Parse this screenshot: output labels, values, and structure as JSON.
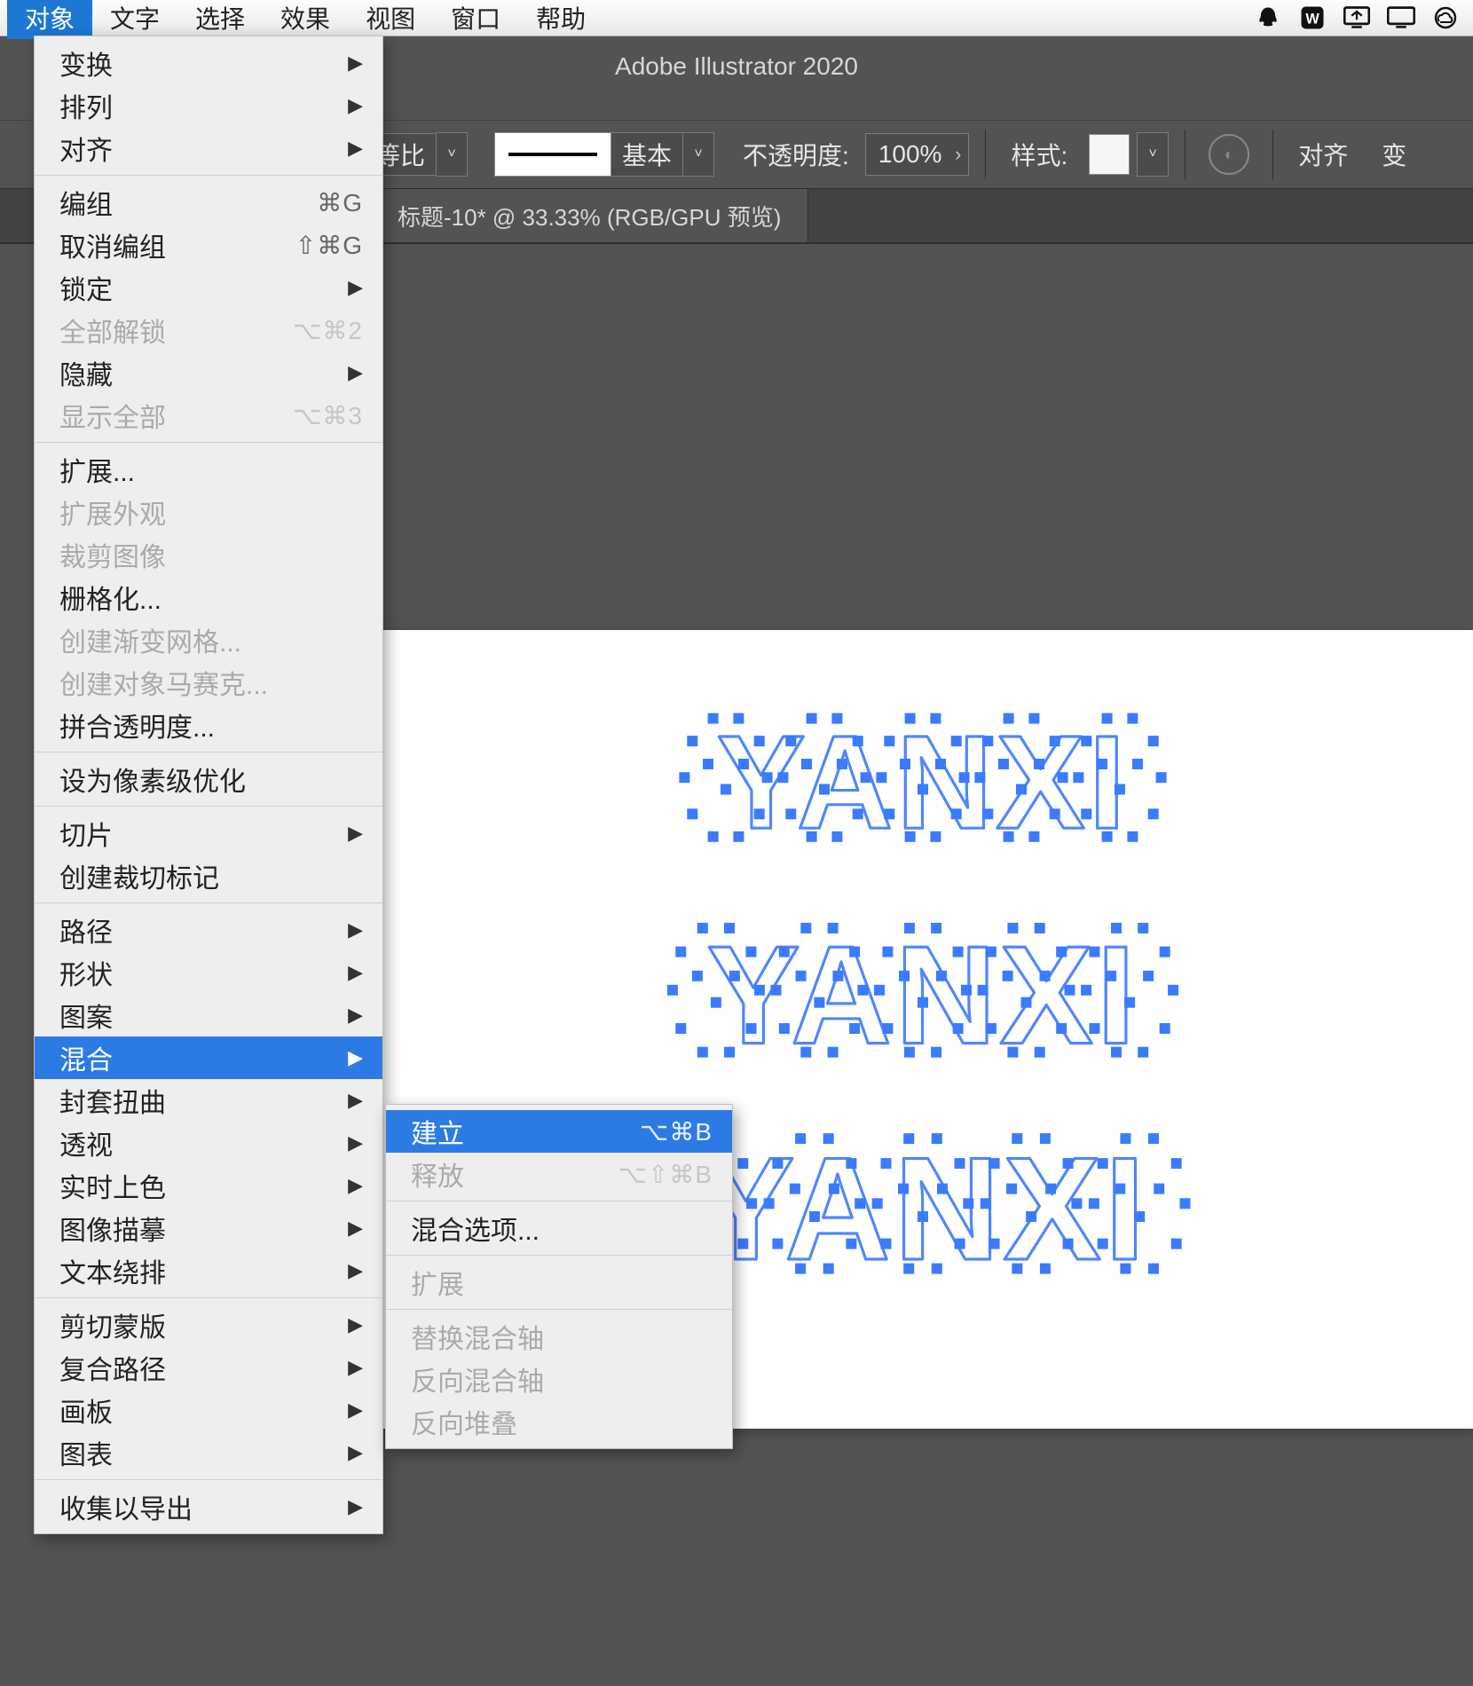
{
  "menubar": {
    "items": [
      "对象",
      "文字",
      "选择",
      "效果",
      "视图",
      "窗口",
      "帮助"
    ],
    "active_index": 0
  },
  "app": {
    "title": "Adobe Illustrator 2020"
  },
  "control_bar": {
    "proportion": "等比",
    "stroke_style": "基本",
    "opacity_label": "不透明度:",
    "opacity_value": "100%",
    "style_label": "样式:",
    "align_label": "对齐",
    "transform_label": "变"
  },
  "doc_tab": {
    "label": "标题-10* @ 33.33% (RGB/GPU 预览)"
  },
  "canvas": {
    "text": "YANXI"
  },
  "object_menu": {
    "groups": [
      [
        {
          "label": "变换",
          "submenu": true
        },
        {
          "label": "排列",
          "submenu": true
        },
        {
          "label": "对齐",
          "submenu": true
        }
      ],
      [
        {
          "label": "编组",
          "shortcut": "⌘G"
        },
        {
          "label": "取消编组",
          "shortcut": "⇧⌘G"
        },
        {
          "label": "锁定",
          "submenu": true
        },
        {
          "label": "全部解锁",
          "shortcut": "⌥⌘2",
          "disabled": true
        },
        {
          "label": "隐藏",
          "submenu": true
        },
        {
          "label": "显示全部",
          "shortcut": "⌥⌘3",
          "disabled": true
        }
      ],
      [
        {
          "label": "扩展..."
        },
        {
          "label": "扩展外观",
          "disabled": true
        },
        {
          "label": "裁剪图像",
          "disabled": true
        },
        {
          "label": "栅格化..."
        },
        {
          "label": "创建渐变网格...",
          "disabled": true
        },
        {
          "label": "创建对象马赛克...",
          "disabled": true
        },
        {
          "label": "拼合透明度..."
        }
      ],
      [
        {
          "label": "设为像素级优化"
        }
      ],
      [
        {
          "label": "切片",
          "submenu": true
        },
        {
          "label": "创建裁切标记"
        }
      ],
      [
        {
          "label": "路径",
          "submenu": true
        },
        {
          "label": "形状",
          "submenu": true
        },
        {
          "label": "图案",
          "submenu": true
        },
        {
          "label": "混合",
          "submenu": true,
          "highlight": true
        },
        {
          "label": "封套扭曲",
          "submenu": true
        },
        {
          "label": "透视",
          "submenu": true
        },
        {
          "label": "实时上色",
          "submenu": true
        },
        {
          "label": "图像描摹",
          "submenu": true
        },
        {
          "label": "文本绕排",
          "submenu": true
        }
      ],
      [
        {
          "label": "剪切蒙版",
          "submenu": true
        },
        {
          "label": "复合路径",
          "submenu": true
        },
        {
          "label": "画板",
          "submenu": true
        },
        {
          "label": "图表",
          "submenu": true
        }
      ],
      [
        {
          "label": "收集以导出",
          "submenu": true
        }
      ]
    ]
  },
  "blend_submenu": {
    "groups": [
      [
        {
          "label": "建立",
          "shortcut": "⌥⌘B",
          "highlight": true
        },
        {
          "label": "释放",
          "shortcut": "⌥⇧⌘B",
          "disabled": true
        }
      ],
      [
        {
          "label": "混合选项..."
        }
      ],
      [
        {
          "label": "扩展",
          "disabled": true
        }
      ],
      [
        {
          "label": "替换混合轴",
          "disabled": true
        },
        {
          "label": "反向混合轴",
          "disabled": true
        },
        {
          "label": "反向堆叠",
          "disabled": true
        }
      ]
    ]
  }
}
